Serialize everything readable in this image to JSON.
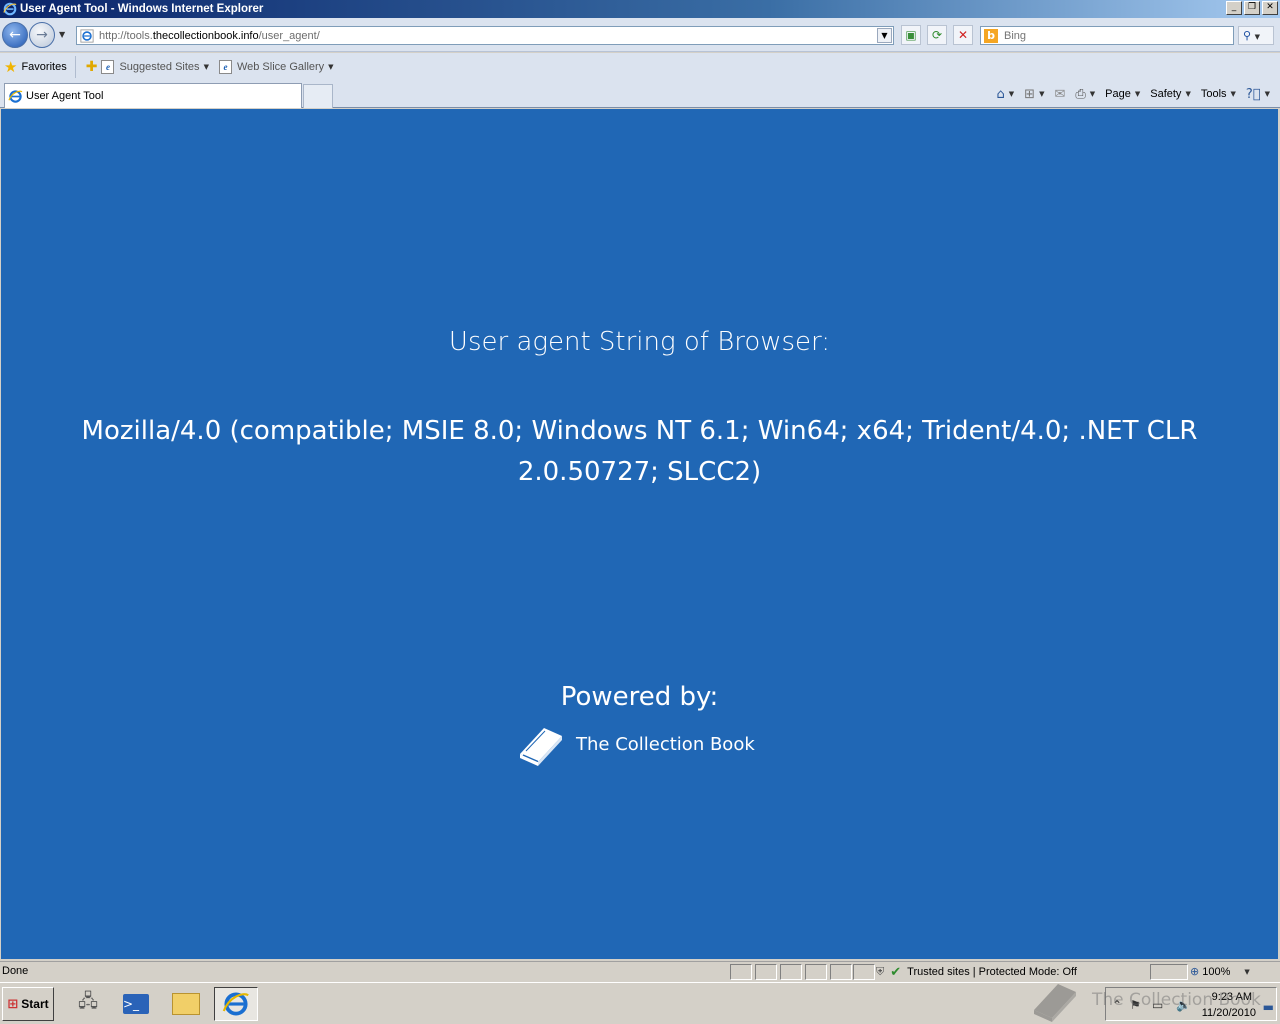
{
  "window": {
    "title": "User Agent Tool - Windows Internet Explorer",
    "buttons": {
      "minimize": "_",
      "restore": "❐",
      "close": "✕"
    }
  },
  "address_bar": {
    "url_prefix": "http://tools.",
    "url_domain": "thecollectionbook.info",
    "url_path": "/user_agent/"
  },
  "search": {
    "placeholder": "Bing",
    "provider_letter": "b"
  },
  "favorites_bar": {
    "favorites_label": "Favorites",
    "links": [
      {
        "label": "Suggested Sites"
      },
      {
        "label": "Web Slice Gallery"
      }
    ]
  },
  "tabs": [
    {
      "label": "User Agent Tool"
    }
  ],
  "command_bar": {
    "page": "Page",
    "safety": "Safety",
    "tools": "Tools"
  },
  "content": {
    "heading": "User agent String of Browser:",
    "user_agent": "Mozilla/4.0 (compatible; MSIE 8.0; Windows NT 6.1; Win64; x64; Trident/4.0; .NET CLR 2.0.50727; SLCC2)",
    "powered_by": "Powered by:",
    "brand": "The Collection Book",
    "background_color": "#2067b5"
  },
  "status_bar": {
    "status": "Done",
    "zone": "Trusted sites | Protected Mode: Off",
    "zoom": "100%"
  },
  "taskbar": {
    "start_label": "Start",
    "clock_time": "9:23 AM",
    "clock_date": "11/20/2010"
  },
  "watermark": {
    "text": "The Collection Book"
  }
}
